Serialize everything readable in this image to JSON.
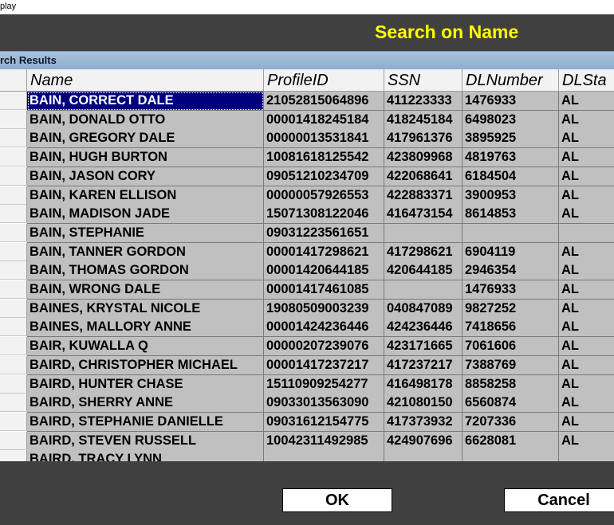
{
  "window": {
    "title": "play"
  },
  "header": {
    "title": "Search on Name"
  },
  "results": {
    "label": "rch Results"
  },
  "table": {
    "columns": [
      "Name",
      "ProfileID",
      "SSN",
      "DLNumber",
      "DLSta"
    ],
    "rows": [
      [
        "BAIN, CORRECT DALE",
        "21052815064896",
        "411223333",
        "1476933",
        "AL"
      ],
      [
        "BAIN, DONALD OTTO",
        "00001418245184",
        "418245184",
        "6498023",
        "AL"
      ],
      [
        "BAIN, GREGORY DALE",
        "00000013531841",
        "417961376",
        "3895925",
        "AL"
      ],
      [
        "BAIN, HUGH BURTON",
        "10081618125542",
        "423809968",
        "4819763",
        "AL"
      ],
      [
        "BAIN, JASON CORY",
        "09051210234709",
        "422068641",
        "6184504",
        "AL"
      ],
      [
        "BAIN, KAREN ELLISON",
        "00000057926553",
        "422883371",
        "3900953",
        "AL"
      ],
      [
        "BAIN, MADISON JADE",
        "15071308122046",
        "416473154",
        "8614853",
        "AL"
      ],
      [
        "BAIN, STEPHANIE",
        "09031223561651",
        "",
        "",
        ""
      ],
      [
        "BAIN, TANNER GORDON",
        "00001417298621",
        "417298621",
        "6904119",
        "AL"
      ],
      [
        "BAIN, THOMAS GORDON",
        "00001420644185",
        "420644185",
        "2946354",
        "AL"
      ],
      [
        "BAIN, WRONG DALE",
        "00001417461085",
        "",
        "1476933",
        "AL"
      ],
      [
        "BAINES, KRYSTAL NICOLE",
        "19080509003239",
        "040847089",
        "9827252",
        "AL"
      ],
      [
        "BAINES, MALLORY ANNE",
        "00001424236446",
        "424236446",
        "7418656",
        "AL"
      ],
      [
        "BAIR, KUWALLA Q",
        "00000207239076",
        "423171665",
        "7061606",
        "AL"
      ],
      [
        "BAIRD, CHRISTOPHER MICHAEL",
        "00001417237217",
        "417237217",
        "7388769",
        "AL"
      ],
      [
        "BAIRD, HUNTER CHASE",
        "15110909254277",
        "416498178",
        "8858258",
        "AL"
      ],
      [
        "BAIRD, SHERRY ANNE",
        "09033013563090",
        "421080150",
        "6560874",
        "AL"
      ],
      [
        "BAIRD, STEPHANIE DANIELLE",
        "09031612154775",
        "417373932",
        "7207336",
        "AL"
      ],
      [
        "BAIRD, STEVEN RUSSELL",
        "10042311492985",
        "424907696",
        "6628081",
        "AL"
      ],
      [
        "BAIRD, TRACY LYNN",
        "",
        "",
        "",
        ""
      ]
    ],
    "selected_row": 0
  },
  "buttons": {
    "ok": "OK",
    "cancel": "Cancel"
  },
  "colors": {
    "header_bg": "#404040",
    "title": "#ffff00",
    "cell_bg": "#c0c0c0",
    "selection": "#00007f",
    "results_bar": "#9fb8d8"
  }
}
